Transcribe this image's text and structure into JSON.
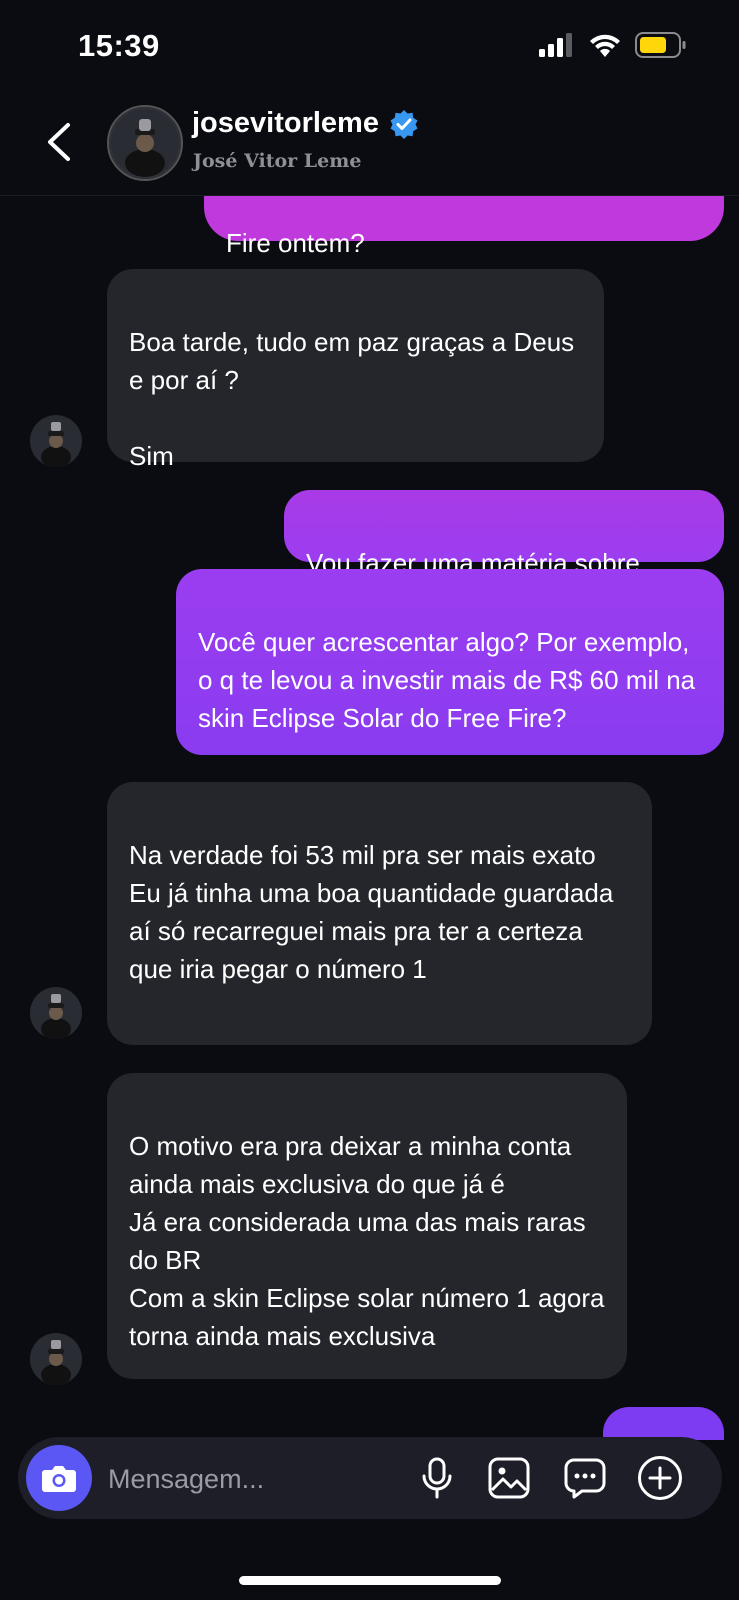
{
  "status_bar": {
    "time": "15:39"
  },
  "header": {
    "username": "josevitorleme",
    "full_name": "José Vitor Leme",
    "verified": true
  },
  "messages": [
    {
      "type": "sent",
      "text": "Fire ontem?"
    },
    {
      "type": "received",
      "text": "Boa tarde, tudo em paz graças a Deus e por aí ?\n\nSim"
    },
    {
      "type": "sent",
      "text": "Vou fazer uma matéria sobre"
    },
    {
      "type": "sent",
      "text": "Você quer acrescentar algo? Por exemplo, o q te levou a investir mais de R$ 60 mil  na skin Eclipse Solar do Free Fire?"
    },
    {
      "type": "received",
      "text": "Na verdade foi 53 mil pra ser mais exato\nEu já tinha uma boa quantidade guardada aí só recarreguei mais pra ter a certeza que iria pegar o número 1"
    },
    {
      "type": "received",
      "text": "O motivo era pra deixar a minha conta ainda mais exclusiva do que já é\nJá era considerada uma das mais raras do BR\nCom a skin Eclipse solar número 1 agora torna ainda mais exclusiva"
    }
  ],
  "composer": {
    "placeholder": "Mensagem..."
  },
  "colors": {
    "sent_top": "#c039dc",
    "sent_bottom": "#8a3cf0",
    "received": "#24262c",
    "camera": "#5b57f5",
    "verified": "#3897f0",
    "battery": "#ffd60a"
  },
  "icons": [
    "back-icon",
    "verified-icon",
    "camera-icon",
    "microphone-icon",
    "gallery-icon",
    "sticker-icon",
    "plus-icon",
    "signal-icon",
    "wifi-icon",
    "battery-icon"
  ]
}
